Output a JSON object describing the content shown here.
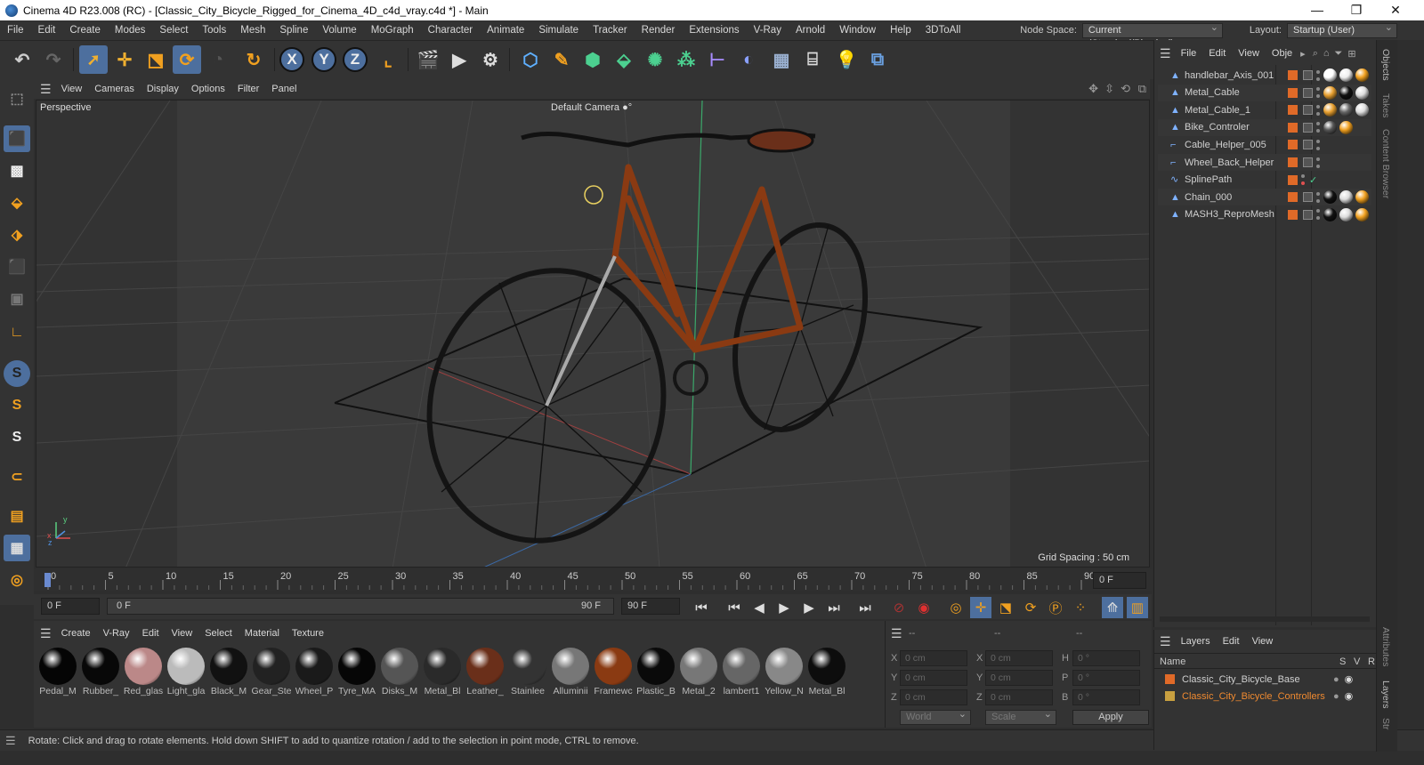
{
  "window": {
    "title": "Cinema 4D R23.008 (RC) - [Classic_City_Bicycle_Rigged_for_Cinema_4D_c4d_vray.c4d *] - Main",
    "minimize": "—",
    "maximize": "❐",
    "close": "✕"
  },
  "menu": {
    "items": [
      "File",
      "Edit",
      "Create",
      "Modes",
      "Select",
      "Tools",
      "Mesh",
      "Spline",
      "Volume",
      "MoGraph",
      "Character",
      "Animate",
      "Simulate",
      "Tracker",
      "Render",
      "Extensions",
      "V-Ray",
      "Arnold",
      "Window",
      "Help",
      "3DToAll"
    ],
    "node_space_label": "Node Space:",
    "node_space_value": "Current (Standard/Physical)",
    "layout_label": "Layout:",
    "layout_value": "Startup (User)"
  },
  "toolbar": {
    "icons": [
      "undo-icon",
      "redo-icon",
      "select-icon",
      "move-icon",
      "scale-icon",
      "rotate-icon",
      "live-selection-icon",
      "recent-tool-icon",
      "x-axis-icon",
      "y-axis-icon",
      "z-axis-icon",
      "coordinate-system-icon",
      "render-view-icon",
      "render-picture-viewer-icon",
      "render-settings-icon",
      "cube-icon",
      "pen-icon",
      "subdivision-icon",
      "extrude-icon",
      "cloner-icon",
      "array-icon",
      "deformer-icon",
      "field-icon",
      "floor-icon",
      "camera-icon",
      "light-icon",
      "python-icon"
    ],
    "x": "X",
    "y": "Y",
    "z": "Z"
  },
  "viewport": {
    "menu": [
      "View",
      "Cameras",
      "Display",
      "Options",
      "Filter",
      "Panel"
    ],
    "projection": "Perspective",
    "camera": "Default Camera",
    "camera_suffix": " ●°",
    "grid_spacing": "Grid Spacing : 50 cm",
    "axis_x": "x",
    "axis_y": "y",
    "axis_z": "z"
  },
  "timeline": {
    "ticks": [
      "0",
      "5",
      "10",
      "15",
      "20",
      "25",
      "30",
      "35",
      "40",
      "45",
      "50",
      "55",
      "60",
      "65",
      "70",
      "75",
      "80",
      "85",
      "90"
    ],
    "current_frame": "0 F"
  },
  "playback": {
    "start": "0 F",
    "range_start": "0 F",
    "range_end": "90 F",
    "end": "90 F"
  },
  "materials": {
    "menu": [
      "Create",
      "V-Ray",
      "Edit",
      "View",
      "Select",
      "Material",
      "Texture"
    ],
    "items": [
      {
        "name": "Pedal_M",
        "color": "#050505"
      },
      {
        "name": "Rubber_",
        "color": "#080808"
      },
      {
        "name": "Red_glas",
        "color": "#b88"
      },
      {
        "name": "Light_gla",
        "color": "#bbb"
      },
      {
        "name": "Black_M",
        "color": "#111"
      },
      {
        "name": "Gear_Ste",
        "color": "#222"
      },
      {
        "name": "Wheel_P",
        "color": "#1a1a1a"
      },
      {
        "name": "Tyre_MA",
        "color": "#060606"
      },
      {
        "name": "Disks_M",
        "color": "#555"
      },
      {
        "name": "Metal_Bl",
        "color": "#2a2a2a"
      },
      {
        "name": "Leather_",
        "color": "#6a2f1a"
      },
      {
        "name": "Stainlee",
        "color": "#333"
      },
      {
        "name": "Alluminii",
        "color": "#777"
      },
      {
        "name": "Framewc",
        "color": "#8a3a12"
      },
      {
        "name": "Plastic_B",
        "color": "#0a0a0a"
      },
      {
        "name": "Metal_2",
        "color": "#777"
      },
      {
        "name": "lambert1",
        "color": "#666"
      },
      {
        "name": "Yellow_N",
        "color": "#888"
      },
      {
        "name": "Metal_Bl",
        "color": "#0d0d0d"
      }
    ]
  },
  "coords": {
    "header": "--",
    "col2": "--",
    "col3": "--",
    "x_label": "X",
    "y_label": "Y",
    "z_label": "Z",
    "h_label": "H",
    "p_label": "P",
    "b_label": "B",
    "pos_x": "0 cm",
    "pos_y": "0 cm",
    "pos_z": "0 cm",
    "size_x": "0 cm",
    "size_y": "0 cm",
    "size_z": "0 cm",
    "rot_h": "0 °",
    "rot_p": "0 °",
    "rot_b": "0 °",
    "world": "World",
    "scale": "Scale",
    "apply": "Apply"
  },
  "objects": {
    "menu": [
      "File",
      "Edit",
      "View",
      "Obje"
    ],
    "items": [
      {
        "name": "handlebar_Axis_001",
        "icon": "polygon-object-icon"
      },
      {
        "name": "Metal_Cable",
        "icon": "polygon-object-icon"
      },
      {
        "name": "Metal_Cable_1",
        "icon": "polygon-object-icon"
      },
      {
        "name": "Bike_Controler",
        "icon": "polygon-object-icon"
      },
      {
        "name": "Cable_Helper_005",
        "icon": "null-object-icon"
      },
      {
        "name": "Wheel_Back_Helper",
        "icon": "null-object-icon"
      },
      {
        "name": "SplinePath",
        "icon": "spline-icon"
      },
      {
        "name": "Chain_000",
        "icon": "polygon-object-icon"
      },
      {
        "name": "MASH3_ReproMesh",
        "icon": "polygon-object-icon"
      }
    ]
  },
  "layers": {
    "menu": [
      "Layers",
      "Edit",
      "View"
    ],
    "col_name": "Name",
    "col_s": "S",
    "col_v": "V",
    "col_r": "R",
    "items": [
      {
        "name": "Classic_City_Bicycle_Base",
        "color": "#e06a28"
      },
      {
        "name": "Classic_City_Bicycle_Controllers",
        "color": "#c8a040"
      }
    ]
  },
  "side_tabs": [
    "Objects",
    "Takes",
    "Content Browser",
    "Attributes",
    "Layers",
    "Str"
  ],
  "status": "Rotate: Click and drag to rotate elements. Hold down SHIFT to add to quantize rotation / add to the selection in point mode, CTRL to remove."
}
